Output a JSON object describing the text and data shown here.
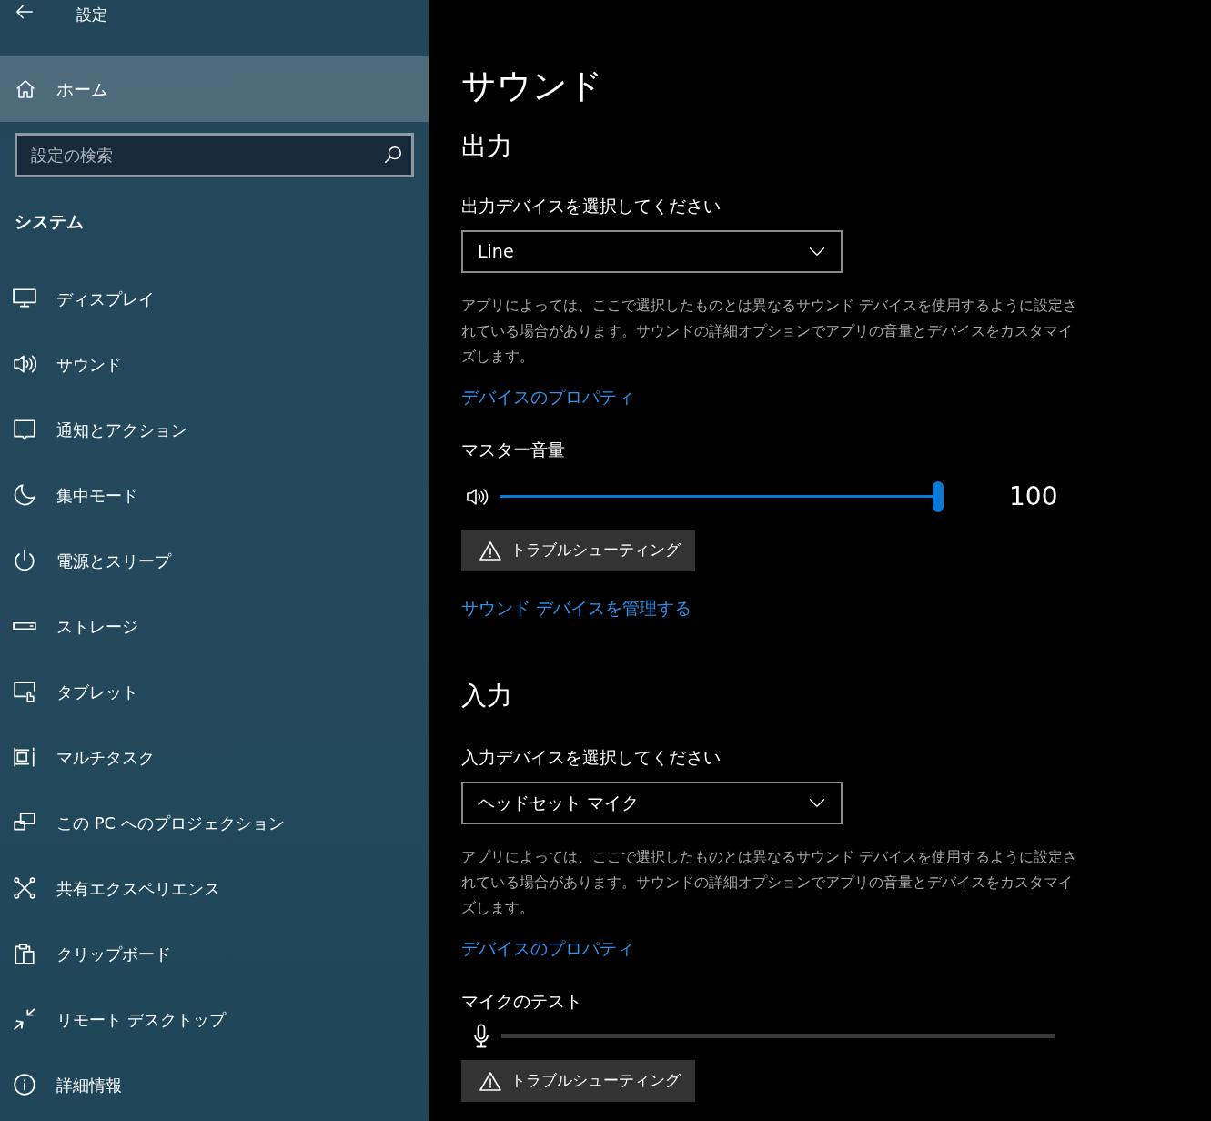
{
  "window": {
    "title": "設定"
  },
  "sidebar": {
    "home": {
      "label": "ホーム",
      "selected": true
    },
    "search": {
      "placeholder": "設定の検索"
    },
    "section": "システム",
    "items": [
      {
        "label": "ディスプレイ",
        "selected": false
      },
      {
        "label": "サウンド",
        "selected": false
      },
      {
        "label": "通知とアクション",
        "selected": false
      },
      {
        "label": "集中モード",
        "selected": false
      },
      {
        "label": "電源とスリープ",
        "selected": false
      },
      {
        "label": "ストレージ",
        "selected": false
      },
      {
        "label": "タブレット",
        "selected": false
      },
      {
        "label": "マルチタスク",
        "selected": false
      },
      {
        "label": "この PC へのプロジェクション",
        "selected": false
      },
      {
        "label": "共有エクスペリエンス",
        "selected": false
      },
      {
        "label": "クリップボード",
        "selected": false
      },
      {
        "label": "リモート デスクトップ",
        "selected": false
      },
      {
        "label": "詳細情報",
        "selected": false
      }
    ]
  },
  "page": {
    "title": "サウンド",
    "output": {
      "heading": "出力",
      "device_label": "出力デバイスを選択してください",
      "device": "Line",
      "description": "アプリによっては、ここで選択したものとは異なるサウンド デバイスを使用するように設定されている場合があります。サウンドの詳細オプションでアプリの音量とデバイスをカスタマイズします。",
      "properties_link": "デバイスのプロパティ",
      "volume_label": "マスター音量",
      "volume": {
        "level": 1.0,
        "reading": "100"
      },
      "troubleshoot": "トラブルシューティング",
      "manage_link": "サウンド デバイスを管理する"
    },
    "input": {
      "heading": "入力",
      "device_label": "入力デバイスを選択してください",
      "device": "ヘッドセット マイク",
      "description": "アプリによっては、ここで選択したものとは異なるサウンド デバイスを使用するように設定されている場合があります。サウンドの詳細オプションでアプリの音量とデバイスをカスタマイズします。",
      "properties_link": "デバイスのプロパティ",
      "test_label": "マイクのテスト",
      "meter": {
        "level": 0
      },
      "troubleshoot": "トラブルシューティング"
    }
  }
}
